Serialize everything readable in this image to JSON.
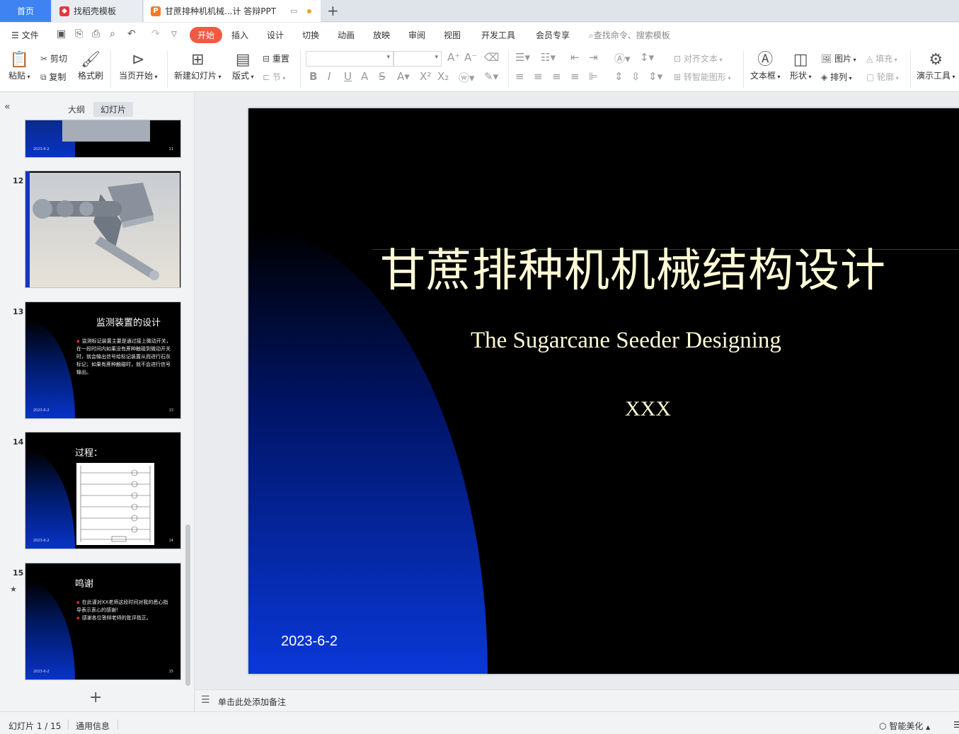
{
  "tabs": {
    "home": "首页",
    "templates": "找稻壳模板",
    "document": "甘蔗排种机机械...计 答辩PPT",
    "add": "+"
  },
  "menu": {
    "file": "文件",
    "items": [
      "开始",
      "插入",
      "设计",
      "切换",
      "动画",
      "放映",
      "审阅",
      "视图",
      "开发工具",
      "会员专享"
    ],
    "search_placeholder": "查找命令、搜索模板"
  },
  "ribbon": {
    "paste": "粘贴",
    "cut": "剪切",
    "copy": "复制",
    "format_painter": "格式刷",
    "from_current": "当页开始",
    "new_slide": "新建幻灯片",
    "layout": "版式",
    "reset": "重置",
    "section": "节",
    "align_text": "对齐文本",
    "smartart": "转智能图形",
    "textbox": "文本框",
    "shape": "形状",
    "picture": "图片",
    "arrange": "排列",
    "fill": "填充",
    "outline": "轮廓",
    "presenter_tools": "演示工具"
  },
  "panel": {
    "outline_tab": "大纲",
    "slides_tab": "幻灯片",
    "add_slide": "+"
  },
  "thumbnails": [
    {
      "number": "",
      "date": "2023-6-2",
      "page": "11"
    },
    {
      "number": "12"
    },
    {
      "number": "13",
      "title": "监测装置的设计",
      "body": "监测标记装置主要是通过接上微动开关，在一段时间内如果没有蔗种触碰到微动开关时，就会输出信号给标记装置从而进行石灰标记；如果有蔗种触碰时，就不会进行信号输出。",
      "date": "2023-6-2",
      "page": "13"
    },
    {
      "number": "14",
      "title": "过程：",
      "date": "2023-6-2",
      "page": "14"
    },
    {
      "number": "15",
      "title": "鸣谢",
      "bullets": [
        "在此谨对XX老师这段时间对我的悉心指导表示衷心的感谢！",
        "感谢各位答辩老师的批评指正。"
      ],
      "date": "2023-6-2",
      "page": "15"
    }
  ],
  "slide": {
    "title": "甘蔗排种机机械结构设计",
    "subtitle": "The Sugarcane Seeder Designing",
    "author": "XXX",
    "date": "2023-6-2"
  },
  "notes": {
    "placeholder": "单击此处添加备注"
  },
  "status": {
    "slide_counter": "幻灯片 1 / 15",
    "theme": "通用信息",
    "beautify": "智能美化"
  },
  "colors": {
    "accent": "#3f82f1",
    "start_tab": "#f05a40",
    "title_text": "#fffbd6"
  }
}
